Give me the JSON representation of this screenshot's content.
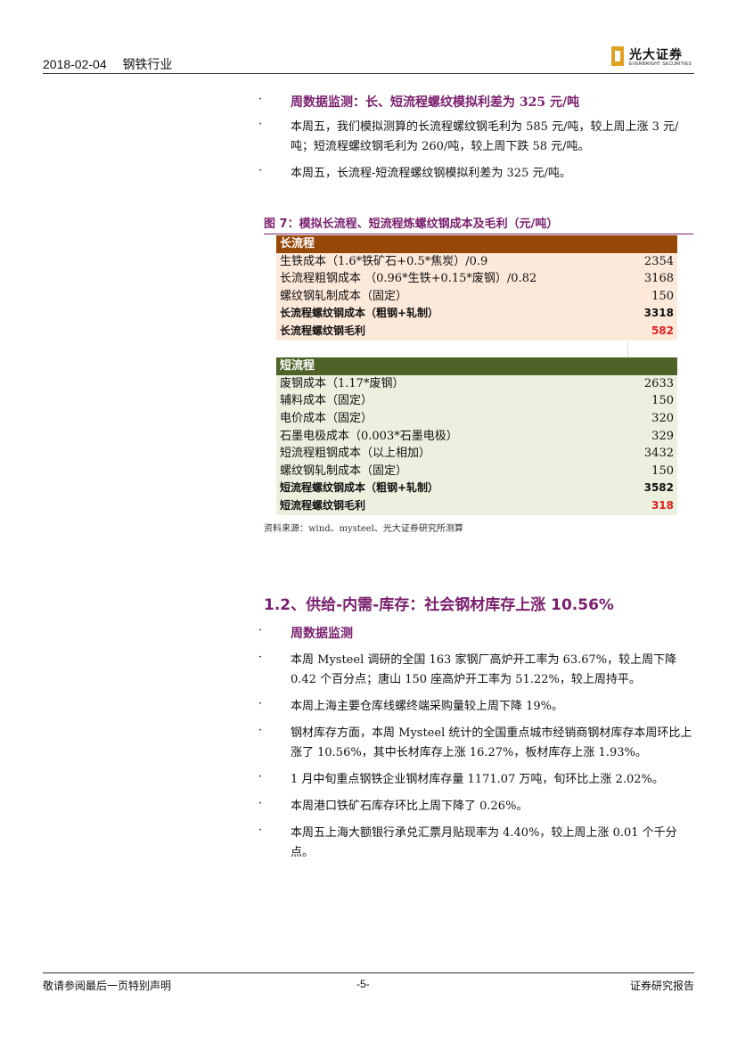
{
  "header": {
    "date": "2018-02-04",
    "industry": "钢铁行业",
    "logo": {
      "cn": "光大证券",
      "en": "EVERBRIGHT SECURITIES"
    }
  },
  "section_weekly": {
    "title": "周数据监测：长、短流程螺纹模拟利差为 325 元/吨",
    "bullets": [
      "本周五，我们模拟测算的长流程螺纹钢毛利为 585 元/吨，较上周上涨 3 元/吨；短流程螺纹钢毛利为 260/吨，较上周下跌 58 元/吨。",
      "本周五，长流程-短流程螺纹钢模拟利差为 325 元/吨。"
    ]
  },
  "figure": {
    "title": "图 7：模拟长流程、短流程炼螺纹钢成本及毛利（元/吨）",
    "long_section": "长流程",
    "long_rows": [
      {
        "label": "生铁成本（1.6*铁矿石+0.5*焦炭）/0.9",
        "value": "2354"
      },
      {
        "label": "长流程粗钢成本 （0.96*生铁+0.15*废钢）/0.82",
        "value": "3168"
      },
      {
        "label": "螺纹钢轧制成本（固定）",
        "value": "150"
      },
      {
        "label": "长流程螺纹钢成本（粗钢+轧制）",
        "value": "3318"
      },
      {
        "label": "长流程螺纹钢毛利",
        "value": "582"
      }
    ],
    "short_section": "短流程",
    "short_rows": [
      {
        "label": "废钢成本（1.17*废钢）",
        "value": "2633"
      },
      {
        "label": "辅料成本（固定）",
        "value": "150"
      },
      {
        "label": "电价成本（固定）",
        "value": "320"
      },
      {
        "label": "石墨电极成本（0.003*石墨电极）",
        "value": "329"
      },
      {
        "label": "短流程粗钢成本（以上相加）",
        "value": "3432"
      },
      {
        "label": "螺纹钢轧制成本（固定）",
        "value": "150"
      },
      {
        "label": "短流程螺纹钢成本（粗钢+轧制）",
        "value": "3582"
      },
      {
        "label": "短流程螺纹钢毛利",
        "value": "318"
      }
    ],
    "source": "资料来源：wind、mysteel、光大证券研究所测算"
  },
  "section_supply": {
    "title": "1.2、供给-内需-库存：社会钢材库存上涨 10.56%",
    "subtitle": "周数据监测",
    "bullets": [
      "本周 Mysteel 调研的全国 163 家钢厂高炉开工率为 63.67%，较上周下降 0.42 个百分点；唐山 150 座高炉开工率为 51.22%，较上周持平。",
      "本周上海主要仓库线螺终端采购量较上周下降 19%。",
      "钢材库存方面，本周 Mysteel 统计的全国重点城市经销商钢材库存本周环比上涨了 10.56%，其中长材库存上涨 16.27%，板材库存上涨 1.93%。",
      "1 月中旬重点钢铁企业钢材库存量 1171.07 万吨，旬环比上涨 2.02%。",
      "本周港口铁矿石库存环比上周下降了 0.26%。",
      "本周五上海大额银行承兑汇票月贴现率为 4.40%，较上周上涨 0.01 个千分点。"
    ]
  },
  "footer": {
    "left": "敬请参阅最后一页特别声明",
    "center": "-5-",
    "right": "证券研究报告"
  }
}
